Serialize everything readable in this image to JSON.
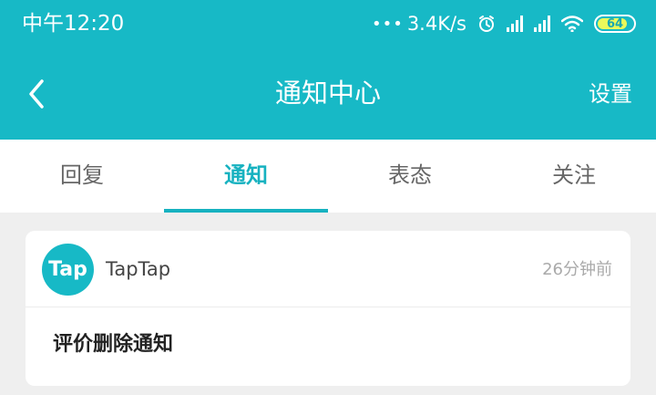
{
  "status_bar": {
    "time": "中午12:20",
    "network_speed": "3.4K/s",
    "battery": "64",
    "icons": [
      "more-dots-icon",
      "alarm-icon",
      "signal-icon",
      "signal-icon",
      "wifi-icon",
      "battery-icon"
    ]
  },
  "header": {
    "title": "通知中心",
    "settings_label": "设置",
    "back_icon": "chevron-left-icon"
  },
  "tabs": [
    {
      "label": "回复",
      "active": false
    },
    {
      "label": "通知",
      "active": true
    },
    {
      "label": "表态",
      "active": false
    },
    {
      "label": "关注",
      "active": false
    }
  ],
  "notification": {
    "avatar_text": "Tap",
    "sender": "TapTap",
    "time": "26分钟前",
    "content": "评价删除通知"
  },
  "colors": {
    "brand": "#17b9c6",
    "active_tab": "#17b2c0",
    "background": "#efefef"
  }
}
